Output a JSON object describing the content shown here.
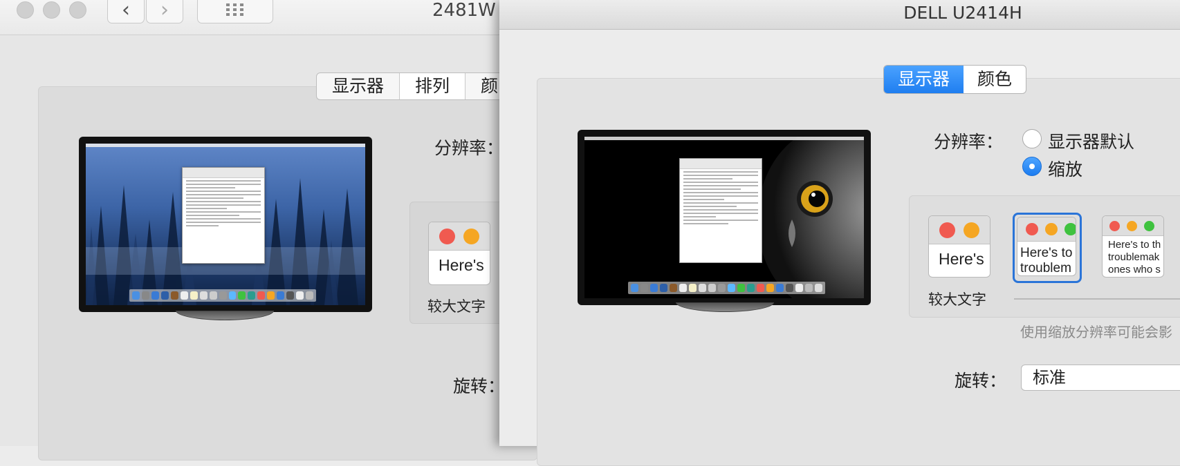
{
  "back_window": {
    "title": "2481W",
    "tabs": [
      {
        "label": "显示器"
      },
      {
        "label": "排列"
      },
      {
        "label": "颜"
      }
    ],
    "resolution_label": "分辨率：",
    "rotation_label": "旋转：",
    "thumbnail": {
      "text": "Here's",
      "caption": "较大文字"
    }
  },
  "front_window": {
    "title": "DELL U2414H",
    "tabs": [
      {
        "label": "显示器",
        "selected": true
      },
      {
        "label": "颜色",
        "selected": false
      }
    ],
    "resolution_label": "分辨率：",
    "resolution_options": [
      {
        "label": "显示器默认",
        "selected": false
      },
      {
        "label": "缩放",
        "selected": true
      }
    ],
    "scale_options": [
      {
        "text": "Here's",
        "caption": "较大文字",
        "selected": false
      },
      {
        "text_line1": "Here's to",
        "text_line2": "troublem",
        "selected": true
      },
      {
        "text_line1": "Here's to th",
        "text_line2": "troublemak",
        "text_line3": "ones who s",
        "selected": false
      }
    ],
    "scale_note": "使用缩放分辨率可能会影",
    "rotation_label": "旋转：",
    "rotation_value": "标准"
  },
  "colors": {
    "accent_blue": "#1f7ef0",
    "close_red": "#f05a50",
    "minimize_yellow": "#f5a623",
    "zoom_green": "#3fc23f"
  },
  "icons": [
    "back-chevron-icon",
    "forward-chevron-icon",
    "grid-icon"
  ]
}
